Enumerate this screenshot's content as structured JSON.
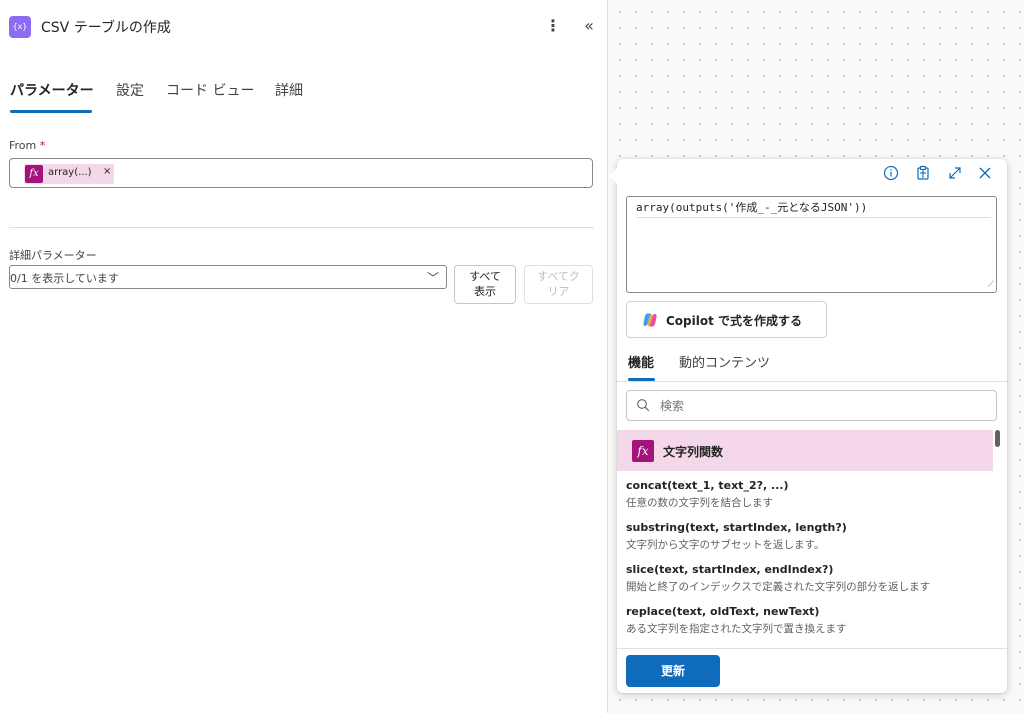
{
  "header": {
    "app_icon_label": "{x}",
    "title": "CSV テーブルの作成",
    "more_glyph": "⋮",
    "collapse_glyph": "«"
  },
  "tabs": [
    {
      "label": "パラメーター",
      "active": true
    },
    {
      "label": "設定",
      "active": false
    },
    {
      "label": "コード ビュー",
      "active": false
    },
    {
      "label": "詳細",
      "active": false
    }
  ],
  "from_field": {
    "label": "From",
    "required_mark": "*",
    "token": {
      "icon_label": "fx",
      "label": "array(...)",
      "remove_glyph": "×"
    }
  },
  "advanced": {
    "label": "詳細パラメーター",
    "select_value": "0/1 を表示しています",
    "chevron_glyph": "﹀",
    "show_all_line1": "すべて",
    "show_all_line2": "表示",
    "clear_all_line1": "すべてク",
    "clear_all_line2": "リア"
  },
  "popup": {
    "icons": [
      "info-icon",
      "clipboard-icon",
      "expand-icon",
      "close-icon"
    ],
    "expression": "array(outputs('作成_-_元となるJSON'))",
    "resize_glyph": "⟋",
    "copilot_label": "Copilot で式を作成する",
    "tabs": [
      {
        "label": "機能",
        "active": true
      },
      {
        "label": "動的コンテンツ",
        "active": false
      }
    ],
    "search_placeholder": "検索",
    "category": {
      "icon_label": "fx",
      "label": "文字列関数"
    },
    "functions": [
      {
        "signature": "concat(text_1, text_2?, ...)",
        "description": "任意の数の文字列を結合します"
      },
      {
        "signature": "substring(text, startIndex, length?)",
        "description": "文字列から文字のサブセットを返します。"
      },
      {
        "signature": "slice(text, startIndex, endIndex?)",
        "description": "開始と終了のインデックスで定義された文字列の部分を返します"
      },
      {
        "signature": "replace(text, oldText, newText)",
        "description": "ある文字列を指定された文字列で置き換えます"
      }
    ],
    "update_label": "更新"
  },
  "colors": {
    "accent": "#0f6cbd",
    "function_pink": "#a4127c",
    "token_bg": "#f5d7ea",
    "app_icon": "#8c6cf0"
  }
}
